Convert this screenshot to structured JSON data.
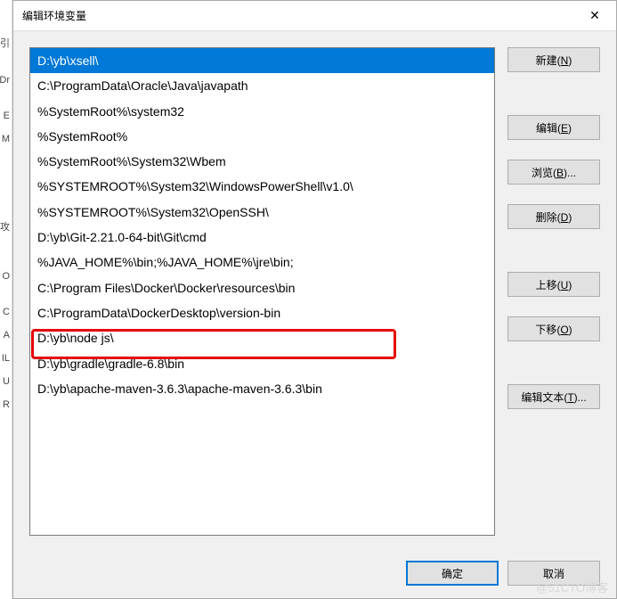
{
  "bg_letters": [
    "引",
    "",
    "Dr",
    "",
    "E",
    "M",
    "",
    "",
    "",
    "",
    "",
    "攻",
    "",
    "",
    "O",
    "",
    "C",
    "A",
    "IL",
    "U",
    "R"
  ],
  "dialog": {
    "title": "编辑环境变量"
  },
  "list": {
    "items": [
      "D:\\yb\\xsell\\",
      "C:\\ProgramData\\Oracle\\Java\\javapath",
      "%SystemRoot%\\system32",
      "%SystemRoot%",
      "%SystemRoot%\\System32\\Wbem",
      "%SYSTEMROOT%\\System32\\WindowsPowerShell\\v1.0\\",
      "%SYSTEMROOT%\\System32\\OpenSSH\\",
      "D:\\yb\\Git-2.21.0-64-bit\\Git\\cmd",
      "%JAVA_HOME%\\bin;%JAVA_HOME%\\jre\\bin;",
      "C:\\Program Files\\Docker\\Docker\\resources\\bin",
      "C:\\ProgramData\\DockerDesktop\\version-bin",
      "D:\\yb\\node js\\",
      "D:\\yb\\gradle\\gradle-6.8\\bin",
      "D:\\yb\\apache-maven-3.6.3\\apache-maven-3.6.3\\bin"
    ],
    "selected_index": 0,
    "highlighted_index": 13
  },
  "buttons": {
    "new": "新建(N)",
    "edit": "编辑(E)",
    "browse": "浏览(B)...",
    "delete": "删除(D)",
    "move_up": "上移(U)",
    "move_down": "下移(O)",
    "edit_text": "编辑文本(T)..."
  },
  "footer": {
    "ok": "确定",
    "cancel": "取消"
  },
  "watermark": "@51CTO博客"
}
